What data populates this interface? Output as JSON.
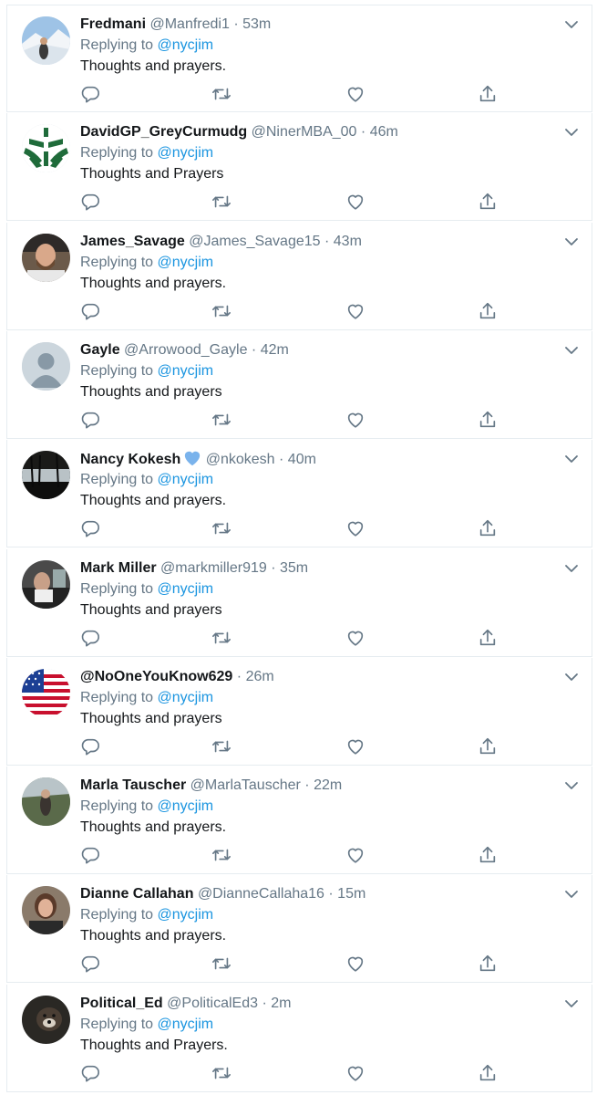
{
  "reply_prefix": "Replying to",
  "icons": {
    "reply": "reply-icon",
    "retweet": "retweet-icon",
    "like": "heart-icon",
    "share": "share-icon",
    "menu": "chevron-down-icon",
    "verified": "blue-heart-icon"
  },
  "colors": {
    "link": "#1b95e0",
    "secondary": "#657786",
    "text": "#14171a",
    "border": "#e6ecf0"
  },
  "tweets": [
    {
      "name": "Fredmani",
      "handle": "@Manfredi1",
      "time": "53m",
      "reply_to": "@nycjim",
      "text": "Thoughts and prayers.",
      "avatar": "avatar-snow-photo"
    },
    {
      "name": "DavidGP_GreyCurmudg",
      "handle": "@NinerMBA_00",
      "time": "46m",
      "reply_to": "@nycjim",
      "text": "Thoughts and Prayers",
      "avatar": "avatar-green-logo"
    },
    {
      "name": "James_Savage",
      "handle": "@James_Savage15",
      "time": "43m",
      "reply_to": "@nycjim",
      "text": "Thoughts and prayers.",
      "avatar": "avatar-man-photo"
    },
    {
      "name": "Gayle",
      "handle": "@Arrowood_Gayle",
      "time": "42m",
      "reply_to": "@nycjim",
      "text": "Thoughts and prayers",
      "avatar": "avatar-default"
    },
    {
      "name": "Nancy Kokesh",
      "handle": "@nkokesh",
      "time": "40m",
      "reply_to": "@nycjim",
      "text": "Thoughts and prayers.",
      "avatar": "avatar-lake-photo",
      "badge": true
    },
    {
      "name": "Mark Miller",
      "handle": "@markmiller919",
      "time": "35m",
      "reply_to": "@nycjim",
      "text": "Thoughts and prayers",
      "avatar": "avatar-person-photo"
    },
    {
      "name": "@NoOneYouKnow629",
      "handle": "",
      "time": "26m",
      "reply_to": "@nycjim",
      "text": "Thoughts and prayers",
      "avatar": "avatar-us-flag"
    },
    {
      "name": "Marla Tauscher",
      "handle": "@MarlaTauscher",
      "time": "22m",
      "reply_to": "@nycjim",
      "text": "Thoughts and prayers.",
      "avatar": "avatar-outdoor-photo"
    },
    {
      "name": "Dianne Callahan",
      "handle": "@DianneCallaha16",
      "time": "15m",
      "reply_to": "@nycjim",
      "text": "Thoughts and prayers.",
      "avatar": "avatar-woman-photo"
    },
    {
      "name": "Political_Ed",
      "handle": "@PoliticalEd3",
      "time": "2m",
      "reply_to": "@nycjim",
      "text": "Thoughts and Prayers.",
      "avatar": "avatar-dog-photo"
    }
  ]
}
